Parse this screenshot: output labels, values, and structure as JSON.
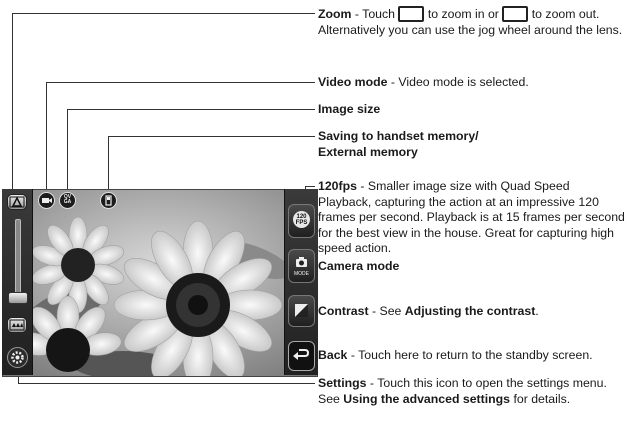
{
  "callouts": {
    "zoom": {
      "label": "Zoom",
      "text_a": " - Touch ",
      "text_b": " to zoom in or ",
      "text_c": " to zoom out. Alternatively you can use the jog wheel around the lens."
    },
    "video_mode": {
      "label": "Video mode",
      "text": " - Video mode is selected."
    },
    "image_size": {
      "label": "Image size"
    },
    "saving": {
      "label_line1": "Saving to handset memory/",
      "label_line2": "External memory"
    },
    "fps": {
      "label": "120fps",
      "text": " - Smaller image size with Quad Speed Playback, capturing the action at an impressive 120 frames per second. Playback is at 15 frames per second for the best view in the house. Great for capturing high speed action."
    },
    "camera_mode": {
      "label": "Camera mode"
    },
    "contrast": {
      "label": "Contrast",
      "text_a": " - See ",
      "link": "Adjusting the contrast",
      "text_b": "."
    },
    "back": {
      "label": "Back",
      "text": " - Touch here to return to the standby screen."
    },
    "settings": {
      "label": "Settings",
      "text_a": " - Touch this icon to open the settings menu. See ",
      "link": "Using the advanced settings",
      "text_b": " for details."
    }
  },
  "screen_icons": {
    "fps_button": "120 FPS",
    "mode_button": "MODE",
    "qvga_icon": "QV GA"
  },
  "icons": [
    "zoom-in-icon",
    "zoom-out-icon",
    "video-mode-icon",
    "image-size-icon",
    "memory-icon",
    "fps-icon",
    "camera-mode-icon",
    "contrast-icon",
    "back-icon",
    "settings-icon"
  ]
}
